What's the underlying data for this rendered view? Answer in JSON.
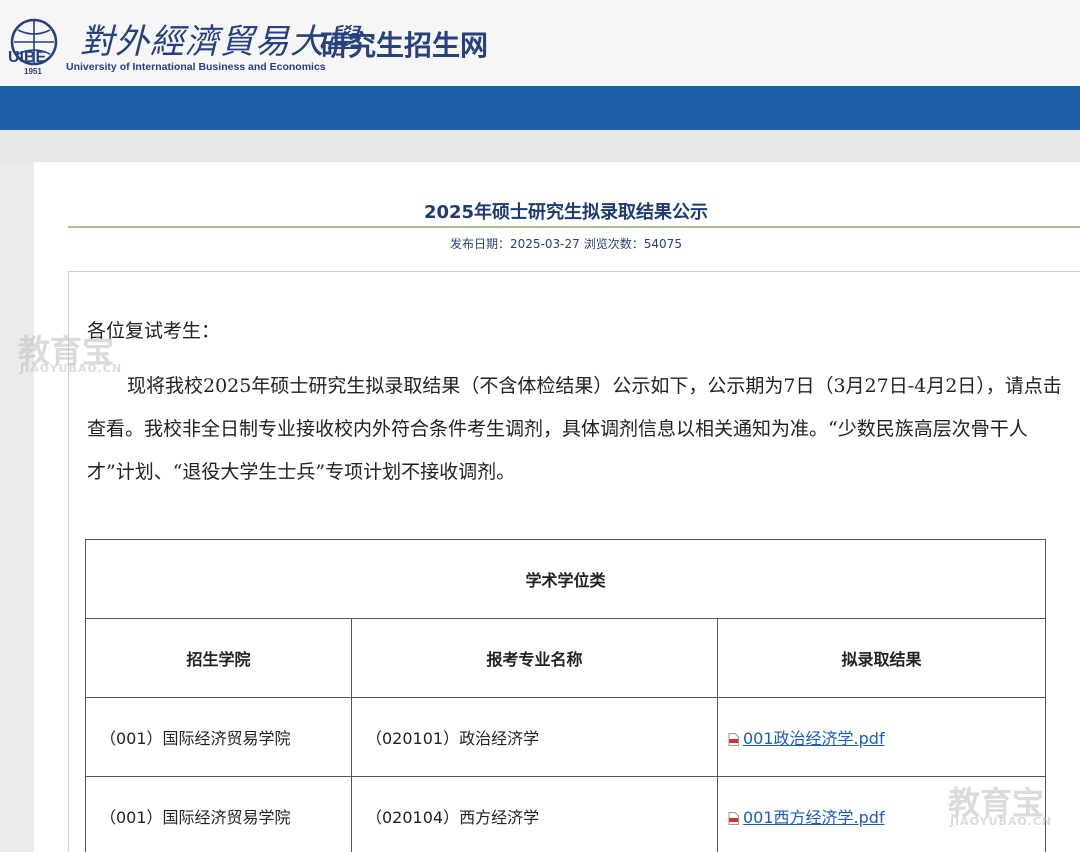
{
  "header": {
    "logo_year": "1951",
    "logo_calligraphy": "對外經濟貿易大學",
    "logo_english": "University of International Business and Economics",
    "site_title": "研究生招生网"
  },
  "article": {
    "title": "2025年硕士研究生拟录取结果公示",
    "meta_date_label": "发布日期：2025-03-27",
    "meta_views_label": "浏览次数：54075",
    "greeting": "各位复试考生：",
    "body": "现将我校2025年硕士研究生拟录取结果（不含体检结果）公示如下，公示期为7日（3月27日-4月2日），请点击查看。我校非全日制专业接收校内外符合条件考生调剂，具体调剂信息以相关通知为准。“少数民族高层次骨干人才”计划、“退役大学生士兵”专项计划不接收调剂。"
  },
  "table": {
    "group_title": "学术学位类",
    "columns": [
      "招生学院",
      "报考专业名称",
      "拟录取结果"
    ],
    "rows": [
      {
        "college": "（001）国际经济贸易学院",
        "major": "（020101）政治经济学",
        "result": "001政治经济学.pdf"
      },
      {
        "college": "（001）国际经济贸易学院",
        "major": "（020104）西方经济学",
        "result": "001西方经济学.pdf"
      }
    ]
  },
  "watermark": {
    "text": "教育宝",
    "sub": "JIAOYUBAO.CN"
  },
  "colors": {
    "navbar": "#1f5fa8",
    "title": "#1c3b74",
    "link": "#1a5bc6",
    "rule": "#a8c58a"
  }
}
